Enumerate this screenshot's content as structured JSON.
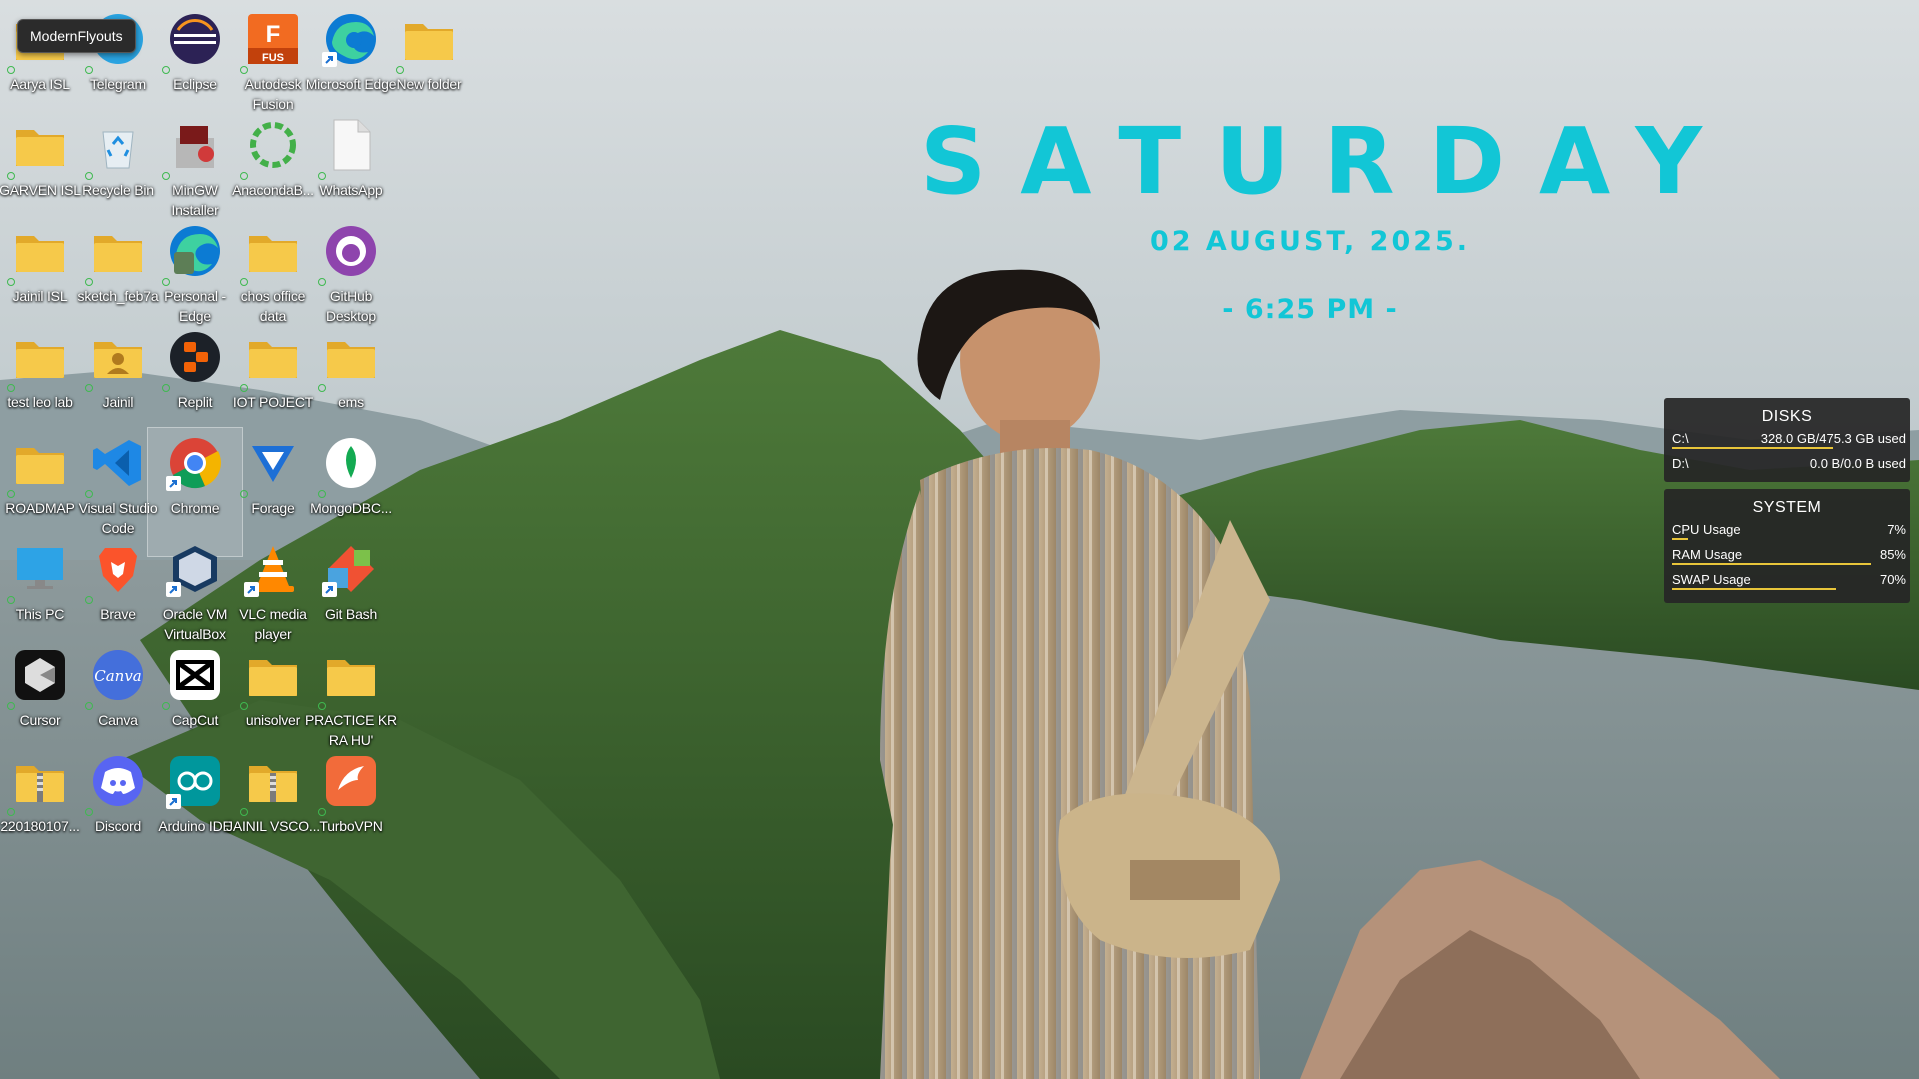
{
  "tooltip": "ModernFlyouts",
  "desktop": {
    "icons": [
      {
        "label": "Aarya ISL",
        "icon": "folder-icon"
      },
      {
        "label": "Telegram",
        "icon": "telegram-icon"
      },
      {
        "label": "Eclipse",
        "icon": "eclipse-icon"
      },
      {
        "label": "Autodesk Fusion",
        "icon": "fusion-icon"
      },
      {
        "label": "Microsoft Edge",
        "icon": "edge-icon"
      },
      {
        "label": "New folder",
        "icon": "folder-icon"
      },
      {
        "label": "GARVEN ISL",
        "icon": "folder-icon"
      },
      {
        "label": "Recycle Bin",
        "icon": "recycle-bin-icon"
      },
      {
        "label": "MinGW Installer",
        "icon": "mingw-icon"
      },
      {
        "label": "AnacondaB...",
        "icon": "anaconda-icon"
      },
      {
        "label": "WhatsApp",
        "icon": "file-icon"
      },
      {
        "label": "Jainil ISL",
        "icon": "folder-icon"
      },
      {
        "label": "sketch_feb7a",
        "icon": "folder-icon"
      },
      {
        "label": "Personal - Edge",
        "icon": "edge-profile-icon"
      },
      {
        "label": "chos office data",
        "icon": "folder-icon"
      },
      {
        "label": "GitHub Desktop",
        "icon": "github-desktop-icon"
      },
      {
        "label": "test leo lab",
        "icon": "folder-icon"
      },
      {
        "label": "Jainil",
        "icon": "user-folder-icon"
      },
      {
        "label": "Replit",
        "icon": "replit-icon"
      },
      {
        "label": "IOT POJECT",
        "icon": "folder-icon"
      },
      {
        "label": "ems",
        "icon": "folder-icon"
      },
      {
        "label": "ROADMAP",
        "icon": "folder-icon"
      },
      {
        "label": "Visual Studio Code",
        "icon": "vscode-icon"
      },
      {
        "label": "Chrome",
        "icon": "chrome-icon"
      },
      {
        "label": "Forage",
        "icon": "forage-icon"
      },
      {
        "label": "MongoDBC...",
        "icon": "mongodb-icon"
      },
      {
        "label": "This PC",
        "icon": "this-pc-icon"
      },
      {
        "label": "Brave",
        "icon": "brave-icon"
      },
      {
        "label": "Oracle VM VirtualBox",
        "icon": "virtualbox-icon"
      },
      {
        "label": "VLC media player",
        "icon": "vlc-icon"
      },
      {
        "label": "Git Bash",
        "icon": "git-bash-icon"
      },
      {
        "label": "Cursor",
        "icon": "cursor-icon"
      },
      {
        "label": "Canva",
        "icon": "canva-icon"
      },
      {
        "label": "CapCut",
        "icon": "capcut-icon"
      },
      {
        "label": "unisolver",
        "icon": "folder-icon"
      },
      {
        "label": "PRACTICE KR RA HU'",
        "icon": "folder-icon"
      },
      {
        "label": "220180107...",
        "icon": "zip-folder-icon"
      },
      {
        "label": "Discord",
        "icon": "discord-icon"
      },
      {
        "label": "Arduino IDE",
        "icon": "arduino-icon"
      },
      {
        "label": "JAINIL VSCO...",
        "icon": "zip-folder-icon"
      },
      {
        "label": "TurboVPN",
        "icon": "turbovpn-icon"
      }
    ]
  },
  "clock": {
    "day": "SATURDAY",
    "date": "02 AUGUST, 2025.",
    "time": "- 6:25 PM -"
  },
  "monitor": {
    "disks": {
      "title": "DISKS",
      "rows": [
        {
          "label": "C:\\",
          "value": "328.0 GB/475.3 GB used",
          "fraction": 0.69
        },
        {
          "label": "D:\\",
          "value": "0.0 B/0.0 B used",
          "fraction": 0.0
        }
      ]
    },
    "system": {
      "title": "SYSTEM",
      "rows": [
        {
          "label": "CPU Usage",
          "value": "7%",
          "fraction": 0.07
        },
        {
          "label": "RAM Usage",
          "value": "85%",
          "fraction": 0.85
        },
        {
          "label": "SWAP Usage",
          "value": "70%",
          "fraction": 0.7
        }
      ]
    },
    "bar_color": "#e8c53a"
  },
  "colors": {
    "accent_cyan": "#12c6d6",
    "folder_yellow": "#f6c94a"
  }
}
